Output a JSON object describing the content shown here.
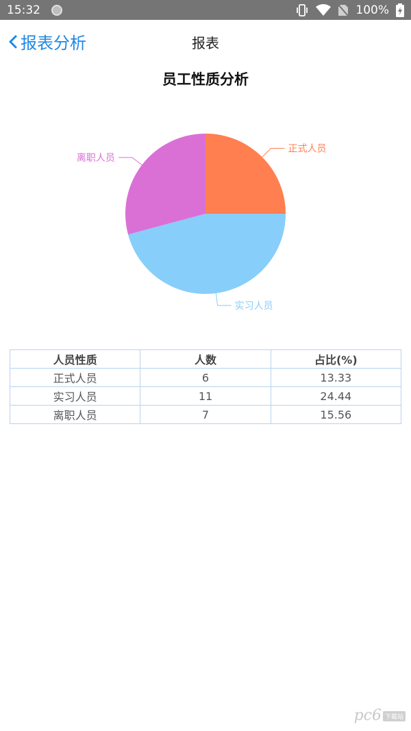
{
  "status": {
    "time": "15:32",
    "battery": "100%"
  },
  "nav": {
    "back_label": "报表分析",
    "title": "报表"
  },
  "chart_data": {
    "type": "pie",
    "title": "员工性质分析",
    "slices": [
      {
        "label": "正式人员",
        "value": 6,
        "color": "#ff7f50"
      },
      {
        "label": "实习人员",
        "value": 11,
        "color": "#87cefa"
      },
      {
        "label": "离职人员",
        "value": 7,
        "color": "#da70d6"
      }
    ]
  },
  "table": {
    "headers": [
      "人员性质",
      "人数",
      "占比(%)"
    ],
    "rows": [
      [
        "正式人员",
        "6",
        "13.33"
      ],
      [
        "实习人员",
        "11",
        "24.44"
      ],
      [
        "离职人员",
        "7",
        "15.56"
      ]
    ]
  },
  "watermark": {
    "text": "pc6",
    "sub": "下载站"
  }
}
